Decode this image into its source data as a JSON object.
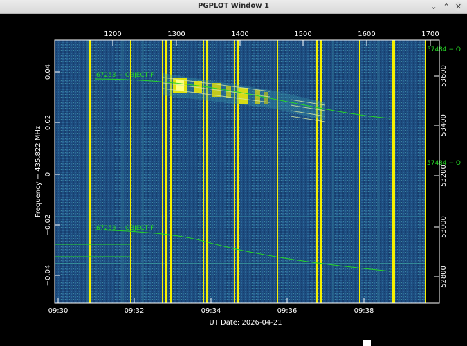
{
  "window": {
    "title": "PGPLOT Window 1",
    "minimize_glyph": "⌄",
    "maximize_glyph": "⌃",
    "close_glyph": "✕"
  },
  "colors": {
    "background": "#000000",
    "waterfall": "#1f4f82",
    "signal": "#f6f000",
    "trace": "#26d626",
    "axis": "#ffffff"
  },
  "plot": {
    "x_axis_label": "UT Date: 2026-04-21",
    "y_axis_label": "Frequency − 435.822 MHz",
    "bottom_ticks": [
      "09:30",
      "09:32",
      "09:34",
      "09:36",
      "09:38"
    ],
    "top_ticks": [
      "1200",
      "1300",
      "1400",
      "1500",
      "1600",
      "1700"
    ],
    "left_ticks": [
      "0.04",
      "0.02",
      "0",
      "−0.02",
      "−0.04"
    ],
    "right_ticks": [
      "53600",
      "53400",
      "53200",
      "53000",
      "52800"
    ],
    "trace_labels": [
      "67253 − OBJECT F",
      "67253 − OBJECT F"
    ],
    "right_labels": [
      "57484 − O",
      "57484 − O"
    ]
  }
}
